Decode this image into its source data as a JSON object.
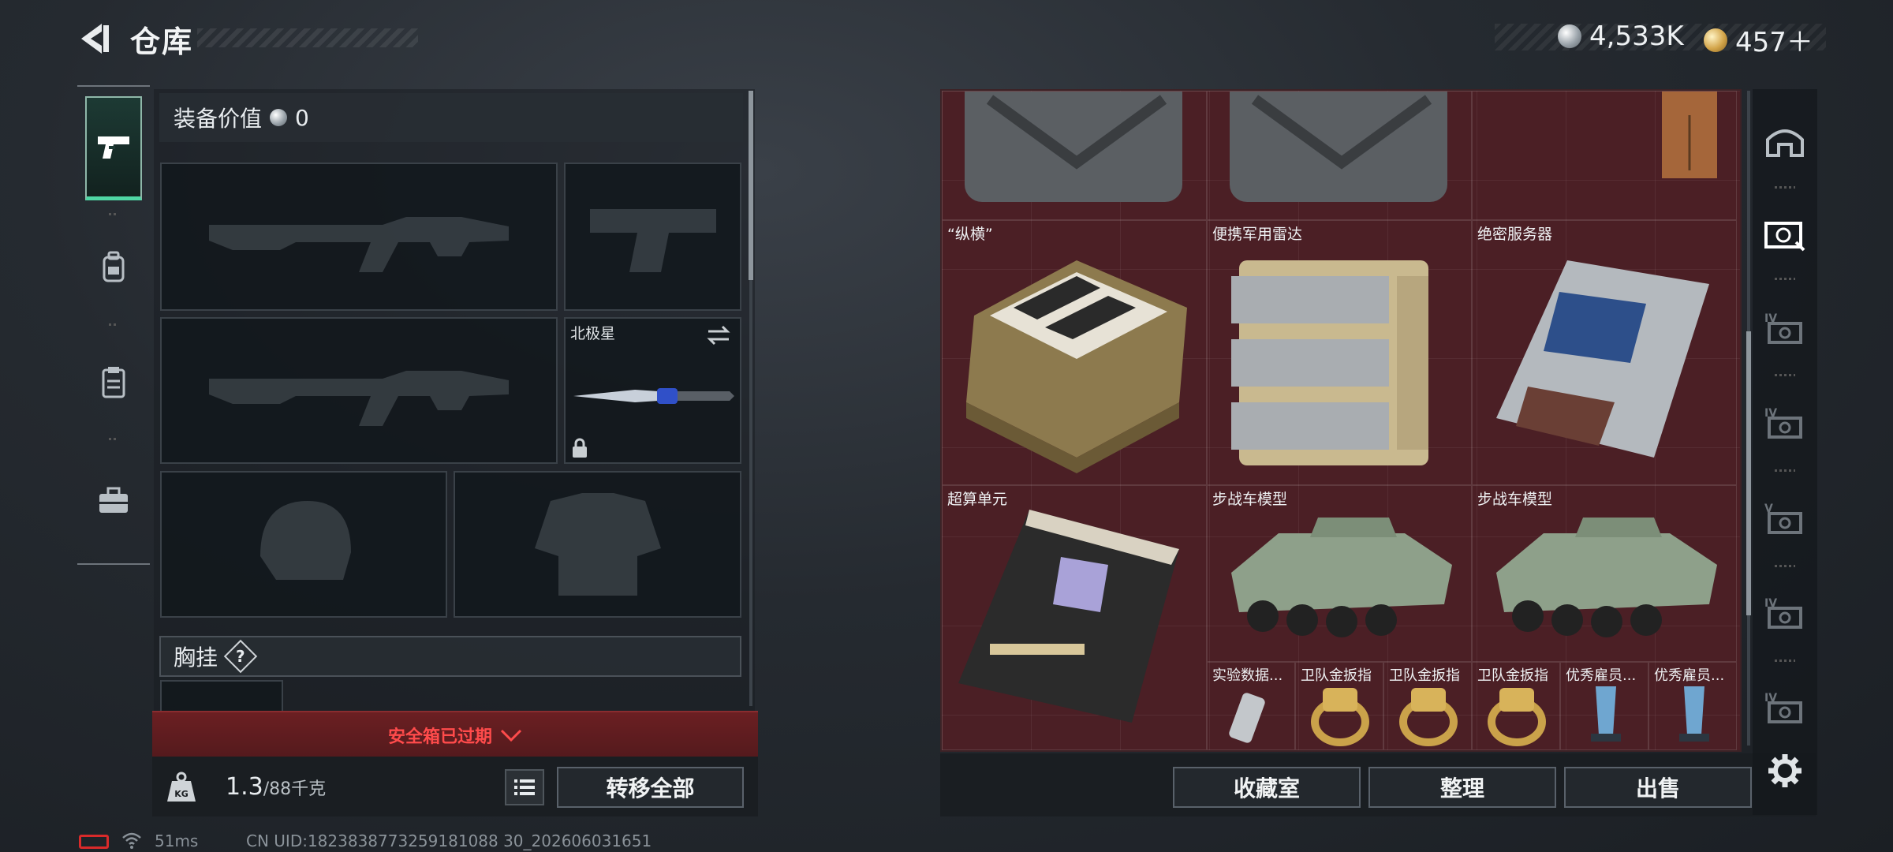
{
  "header": {
    "title": "仓库"
  },
  "currencies": [
    {
      "icon": "silver-coin-icon",
      "value": "4,533K"
    },
    {
      "icon": "gold-coin-icon",
      "value": "457＋"
    }
  ],
  "left_tabs": [
    {
      "icon": "pistol-icon",
      "active": true
    },
    {
      "icon": "backpack-icon",
      "active": false
    },
    {
      "icon": "clipboard-icon",
      "active": false
    },
    {
      "icon": "briefcase-icon",
      "active": false
    }
  ],
  "loadout": {
    "equip_value_label": "装备价值",
    "equip_value": "0",
    "melee_slot_label": "北极星",
    "chest_rig_label": "胸挂",
    "help_mark": "?"
  },
  "safe_box": {
    "status": "安全箱已过期"
  },
  "weight": {
    "current": "1.3",
    "max_unit": "/88千克",
    "icon_text": "KG"
  },
  "buttons": {
    "transfer_all": "转移全部",
    "collection_room": "收藏室",
    "organize": "整理",
    "sell": "出售"
  },
  "items": [
    {
      "name": "“纵横”"
    },
    {
      "name": "便携军用雷达"
    },
    {
      "name": "绝密服务器"
    },
    {
      "name": "超算单元"
    },
    {
      "name": "步战车模型"
    },
    {
      "name": "步战车模型"
    },
    {
      "name": "实验数据..."
    },
    {
      "name": "卫队金扳指"
    },
    {
      "name": "卫队金扳指"
    },
    {
      "name": "卫队金扳指"
    },
    {
      "name": "优秀雇员..."
    },
    {
      "name": "优秀雇员..."
    }
  ],
  "right_rail": [
    {
      "icon": "shelter-icon"
    },
    {
      "icon": "storage-tab-icon"
    },
    {
      "icon": "storage-tab-iv-icon",
      "level": "IV"
    },
    {
      "icon": "storage-tab-iv-icon",
      "level": "IV"
    },
    {
      "icon": "storage-tab-v-icon",
      "level": "V"
    },
    {
      "icon": "storage-tab-iv-icon",
      "level": "IV"
    },
    {
      "icon": "storage-tab-iv-icon",
      "level": "IV"
    },
    {
      "icon": "settings-gear-icon"
    }
  ],
  "status_bar": {
    "ping": "51ms",
    "uid": "CN UID:1823838773259181088 30_202606031651"
  },
  "colors": {
    "accent_green": "#4fd6a4",
    "expired_red": "#ff4b4b",
    "grid_bg": "#4b1f25"
  }
}
